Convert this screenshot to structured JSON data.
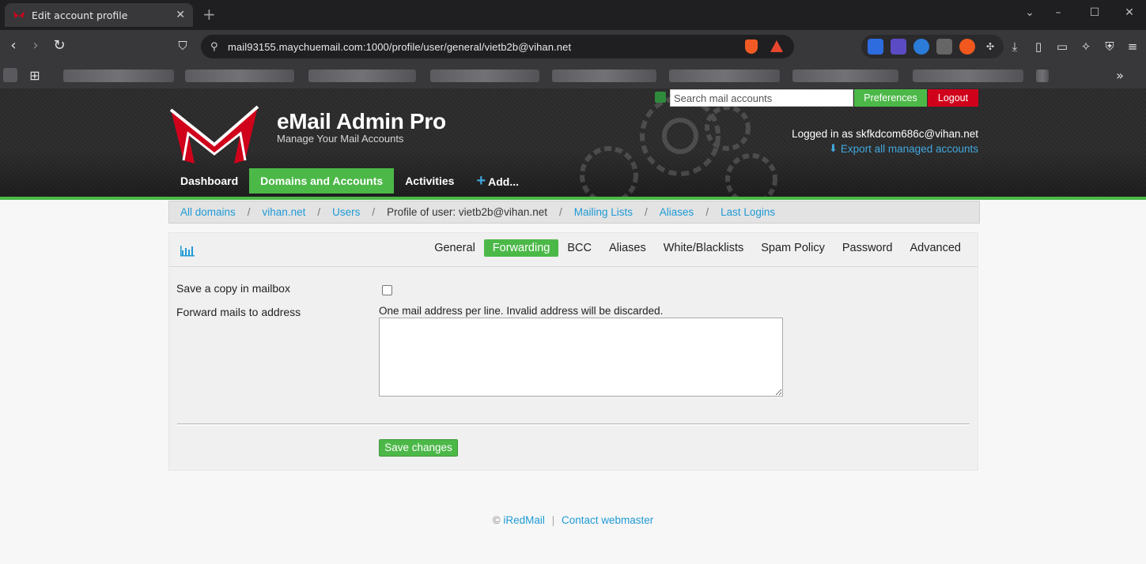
{
  "browser": {
    "tab_title": "Edit account profile",
    "tab_close": "✕",
    "new_tab": "+",
    "url": "mail93155.maychuemail.com:1000/profile/user/general/vietb2b@vihan.net",
    "more_bookmarks": "»"
  },
  "header": {
    "brand": "eMail Admin Pro",
    "tagline": "Manage Your Mail Accounts",
    "search_placeholder": "Search mail accounts",
    "preferences": "Preferences",
    "logout": "Logout",
    "logged_in": "Logged in as skfkdcom686c@vihan.net",
    "export": "Export all managed accounts",
    "accent_color": "#4cb848",
    "danger_color": "#d0021b",
    "link_color": "#41a7dc"
  },
  "mainnav": {
    "dashboard": "Dashboard",
    "domains": "Domains and Accounts",
    "activities": "Activities",
    "add": "Add..."
  },
  "breadcrumb": {
    "all_domains": "All domains",
    "domain": "vihan.net",
    "users": "Users",
    "current": "Profile of user: vietb2b@vihan.net",
    "mailing_lists": "Mailing Lists",
    "aliases": "Aliases",
    "last_logins": "Last Logins",
    "sep": "/"
  },
  "subtabs": {
    "general": "General",
    "forwarding": "Forwarding",
    "bcc": "BCC",
    "aliases": "Aliases",
    "white_blacklists": "White/Blacklists",
    "spam_policy": "Spam Policy",
    "password": "Password",
    "advanced": "Advanced"
  },
  "form": {
    "save_copy_label": "Save a copy in mailbox",
    "save_copy_checked": false,
    "forward_label": "Forward mails to address",
    "forward_hint": "One mail address per line. Invalid address will be discarded.",
    "forward_value": "",
    "save_button": "Save changes"
  },
  "footer": {
    "copyright": "©",
    "iredmail": "iRedMail",
    "separator": "|",
    "contact": "Contact webmaster"
  }
}
